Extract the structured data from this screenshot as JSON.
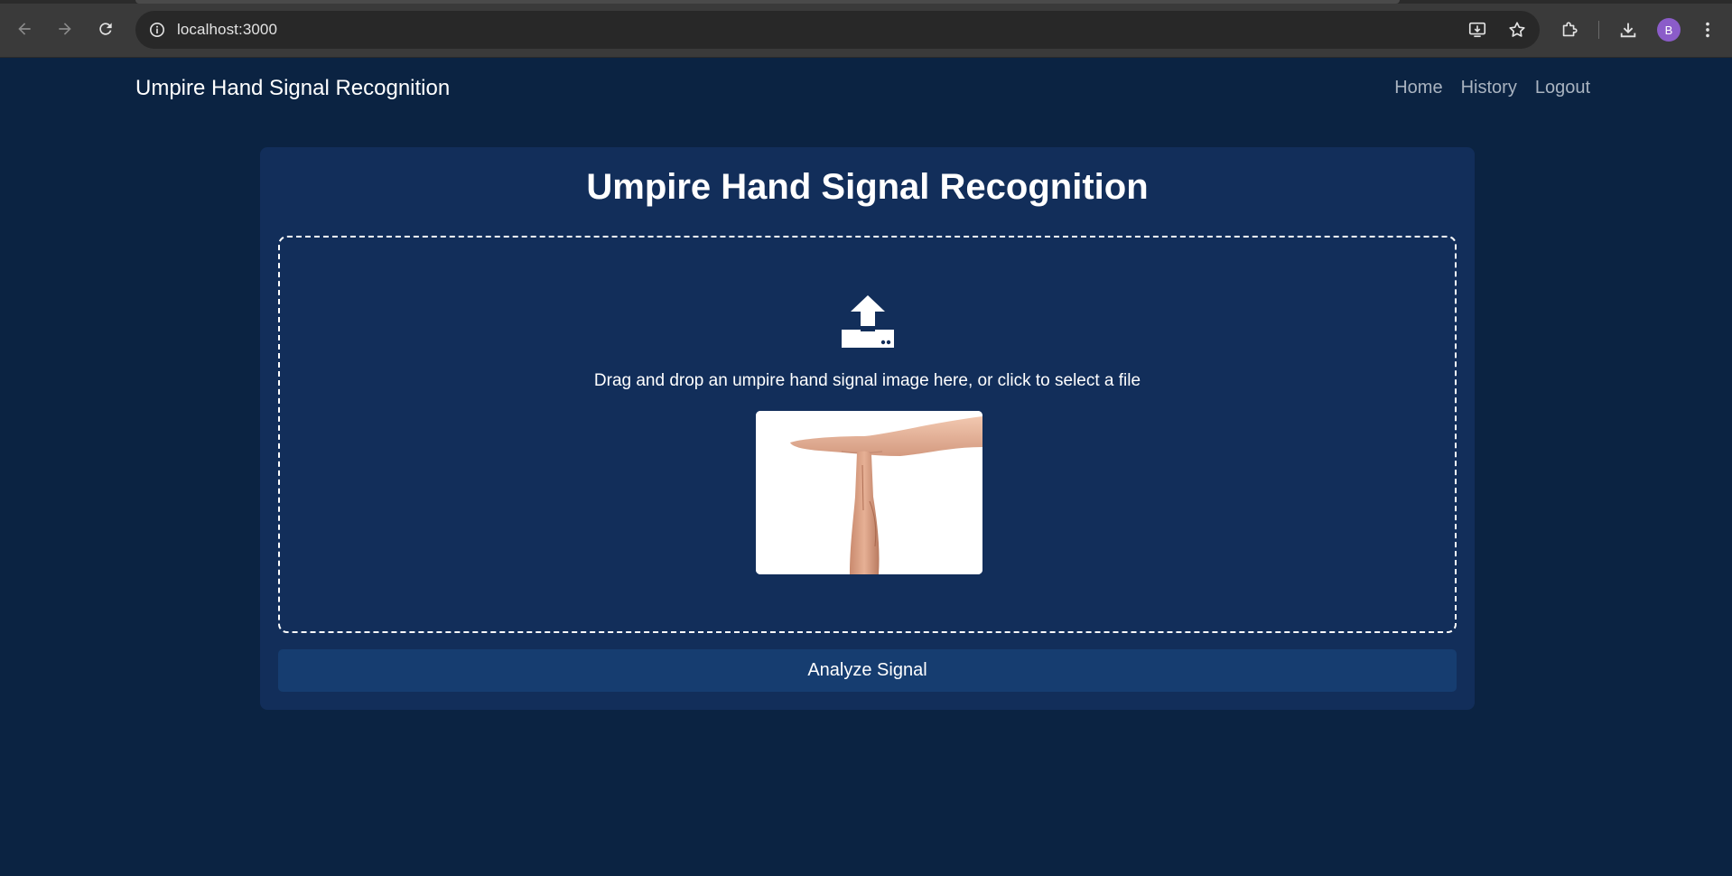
{
  "browser": {
    "url": "localhost:3000",
    "profile_initial": "B",
    "icons": [
      "back-icon",
      "forward-icon",
      "reload-icon",
      "site-info-icon",
      "install-app-icon",
      "bookmark-star-icon",
      "extensions-icon",
      "downloads-icon",
      "menu-dots-icon"
    ]
  },
  "navbar": {
    "brand": "Umpire Hand Signal Recognition",
    "links": [
      "Home",
      "History",
      "Logout"
    ]
  },
  "main": {
    "title": "Umpire Hand Signal Recognition",
    "dropzone": {
      "icon": "upload-icon",
      "text": "Drag and drop an umpire hand signal image here, or click to select a file"
    },
    "analyze_button": "Analyze Signal"
  },
  "colors": {
    "page_bg": "#0b2342",
    "card_bg": "#122e5a",
    "button_bg": "#163d70",
    "nav_link": "#a9b3c0",
    "avatar": "#8b5cc9"
  }
}
